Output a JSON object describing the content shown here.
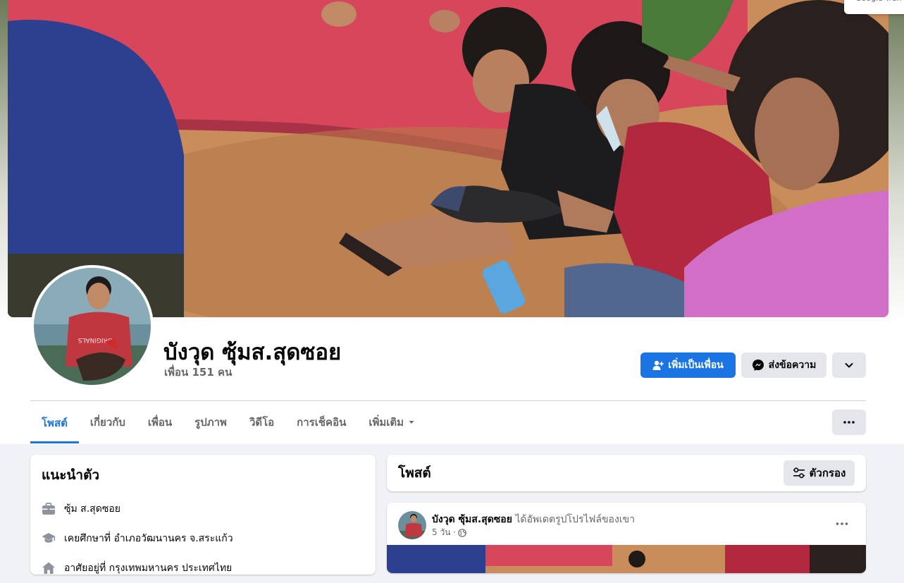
{
  "translate_chip": {
    "label": "Google Tran"
  },
  "profile": {
    "name": "บังวุด ซุ้มส.สุดซอย",
    "friends_count": "เพื่อน 151 คน"
  },
  "actions": {
    "add_friend": "เพิ่มเป็นเพื่อน",
    "message": "ส่งข้อความ"
  },
  "tabs": [
    {
      "label": "โพสต์"
    },
    {
      "label": "เกี่ยวกับ"
    },
    {
      "label": "เพื่อน"
    },
    {
      "label": "รูปภาพ"
    },
    {
      "label": "วิดีโอ"
    },
    {
      "label": "การเช็คอิน"
    },
    {
      "label": "เพิ่มเติม"
    }
  ],
  "intro": {
    "title": "แนะนำตัว",
    "items": [
      {
        "icon": "briefcase-icon",
        "text": "ซุ้ม ส.สุดซอย"
      },
      {
        "icon": "graduation-cap-icon",
        "text": "เคยศึกษาที่ อำเภอวัฒนานคร จ.สระแก้ว"
      },
      {
        "icon": "home-icon",
        "text": "อาศัยอยู่ที่ กรุงเทพมหานคร ประเทศไทย"
      }
    ]
  },
  "posts": {
    "title": "โพสต์",
    "filter_label": "ตัวกรอง",
    "first": {
      "author": "บังวุด ซุ้มส.สุดซอย",
      "action": "ได้อัพเดตรูปโปรไฟล์ของเขา",
      "time": "5 วัน ·"
    }
  },
  "colors": {
    "accent": "#1b74e4",
    "secondary_button": "#e4e6eb",
    "page_bg": "#f0f2f5",
    "muted_text": "#65676b"
  }
}
